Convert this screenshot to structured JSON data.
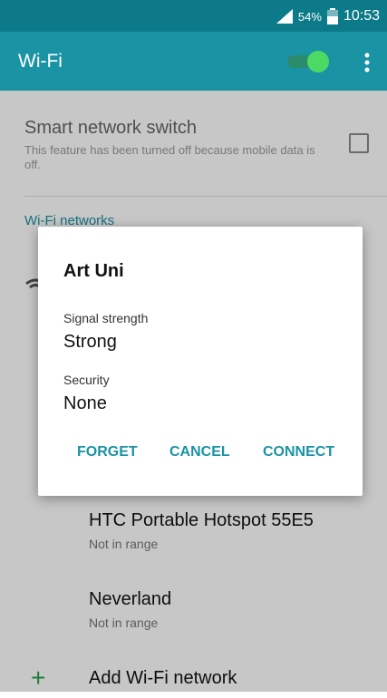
{
  "status_bar": {
    "battery": "54%",
    "time": "10:53"
  },
  "app_bar": {
    "title": "Wi-Fi",
    "wifi_enabled": true
  },
  "smart_switch": {
    "title": "Smart network switch",
    "description": "This feature has been turned off because mobile data is off.",
    "checked": false
  },
  "section_header": "Wi-Fi networks",
  "networks": [
    {
      "name": "HTC Portable Hotspot 55E5",
      "status": "Not in range"
    },
    {
      "name": "Neverland",
      "status": "Not in range"
    }
  ],
  "add_network": {
    "label": "Add Wi-Fi network"
  },
  "dialog": {
    "title": "Art Uni",
    "signal_label": "Signal strength",
    "signal_value": "Strong",
    "security_label": "Security",
    "security_value": "None",
    "forget": "FORGET",
    "cancel": "CANCEL",
    "connect": "CONNECT"
  },
  "colors": {
    "status_bar": "#0d7a8a",
    "app_bar": "#1a93a4",
    "toggle_on": "#4cd964",
    "accent": "#1a93a4"
  }
}
